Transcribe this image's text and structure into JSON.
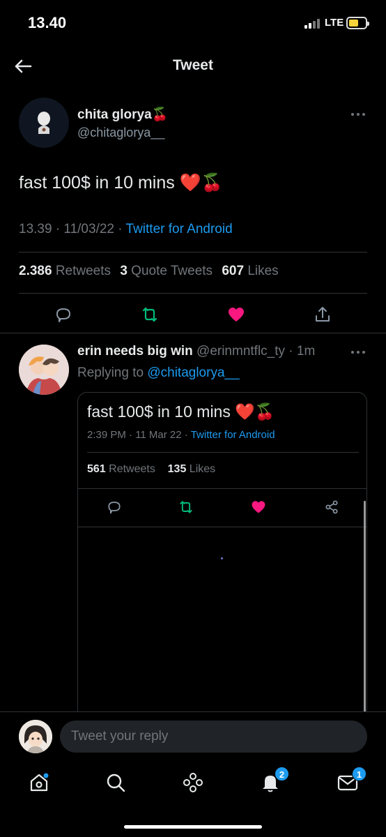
{
  "status_bar": {
    "time": "13.40",
    "network": "LTE"
  },
  "header": {
    "title": "Tweet"
  },
  "main_tweet": {
    "author_name": "chita glorya🍒",
    "author_handle": "@chitaglorya__",
    "text": "fast 100$ in 10 mins ❤️🍒",
    "time_date": "13.39 · 11/03/22 · ",
    "source": "Twitter for Android",
    "retweets_count": "2.386",
    "retweets_label": "Retweets",
    "quotes_count": "3",
    "quotes_label": "Quote Tweets",
    "likes_count": "607",
    "likes_label": "Likes"
  },
  "reply": {
    "author_name": "erin needs big win",
    "author_handle_time": " @erinmntflc_ty · 1m",
    "replying_label": "Replying to ",
    "replying_mention": "@chitaglorya__",
    "embed": {
      "text": "fast 100$ in 10 mins ❤️🍒",
      "time_date": "2:39 PM · 11 Mar 22 · ",
      "source": "Twitter for Android",
      "retweets_count": "561",
      "retweets_label": "Retweets",
      "likes_count": "135",
      "likes_label": "Likes"
    }
  },
  "reply_bar": {
    "placeholder": "Tweet your reply"
  },
  "bottom_nav": {
    "notifications_badge": "2",
    "messages_badge": "1"
  },
  "colors": {
    "accent": "#1d9bf0",
    "retweet": "#00ba7c",
    "like": "#f91880"
  }
}
